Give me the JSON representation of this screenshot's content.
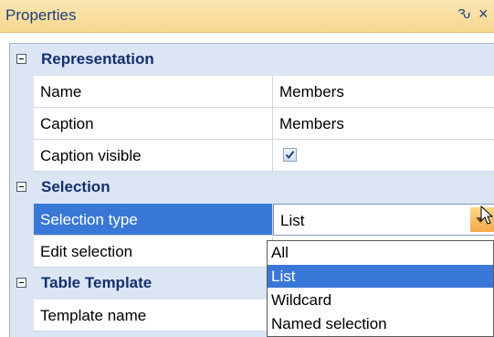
{
  "panel": {
    "title": "Properties",
    "pin_glyph": "Ԅ",
    "close_glyph": "×"
  },
  "categories": [
    {
      "label": "Representation"
    },
    {
      "label": "Selection"
    },
    {
      "label": "Table Template"
    }
  ],
  "properties": {
    "name": {
      "label": "Name",
      "value": "Members"
    },
    "caption": {
      "label": "Caption",
      "value": "Members"
    },
    "caption_visible": {
      "label": "Caption visible",
      "checked": true
    },
    "selection_type": {
      "label": "Selection type",
      "value": "List"
    },
    "edit_selection": {
      "label": "Edit selection",
      "value": ""
    },
    "template_name": {
      "label": "Template name",
      "value": ""
    }
  },
  "dropdown": {
    "options": [
      "All",
      "List",
      "Wildcard",
      "Named selection"
    ],
    "selected": "List"
  },
  "colors": {
    "title_bar": "#f7d78f",
    "category_bg": "#dbe5f3",
    "selection": "#3a78d7",
    "dropdown_button": "#f5a94b"
  },
  "icons": [
    "pin-icon",
    "close-icon",
    "collapse-toggle-icon",
    "checkbox-checkmark-icon",
    "chevron-down-icon",
    "mouse-cursor-icon"
  ]
}
